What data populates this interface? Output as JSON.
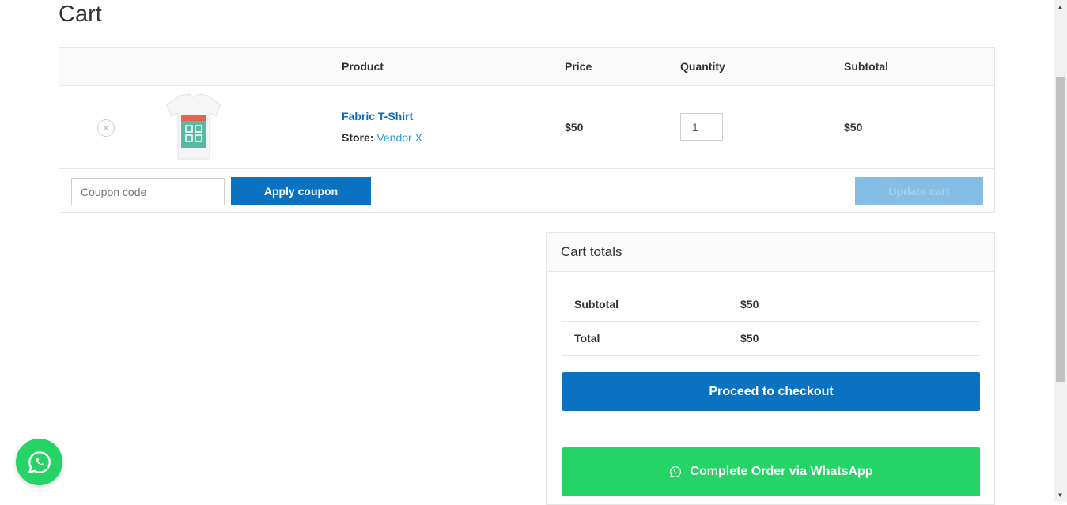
{
  "page": {
    "title": "Cart"
  },
  "cart_table": {
    "headers": {
      "product": "Product",
      "price": "Price",
      "quantity": "Quantity",
      "subtotal": "Subtotal"
    },
    "items": [
      {
        "remove_icon": "×",
        "name": "Fabric T-Shirt",
        "store_label": "Store:",
        "vendor": "Vendor X",
        "price": "$50",
        "quantity": "1",
        "subtotal": "$50"
      }
    ]
  },
  "coupon": {
    "placeholder": "Coupon code",
    "apply_label": "Apply coupon"
  },
  "update_label": "Update cart",
  "totals": {
    "title": "Cart totals",
    "rows": [
      {
        "label": "Subtotal",
        "value": "$50"
      },
      {
        "label": "Total",
        "value": "$50"
      }
    ],
    "checkout_label": "Proceed to checkout",
    "whatsapp_label": "Complete Order via WhatsApp"
  },
  "icons": {
    "whatsapp": "whatsapp-icon",
    "remove": "close-icon"
  },
  "colors": {
    "primary": "#0a72c0",
    "whatsapp": "#25d366",
    "link": "#0b6bbf",
    "vendor_link": "#2a9ed4",
    "disabled": "#86bde4"
  }
}
